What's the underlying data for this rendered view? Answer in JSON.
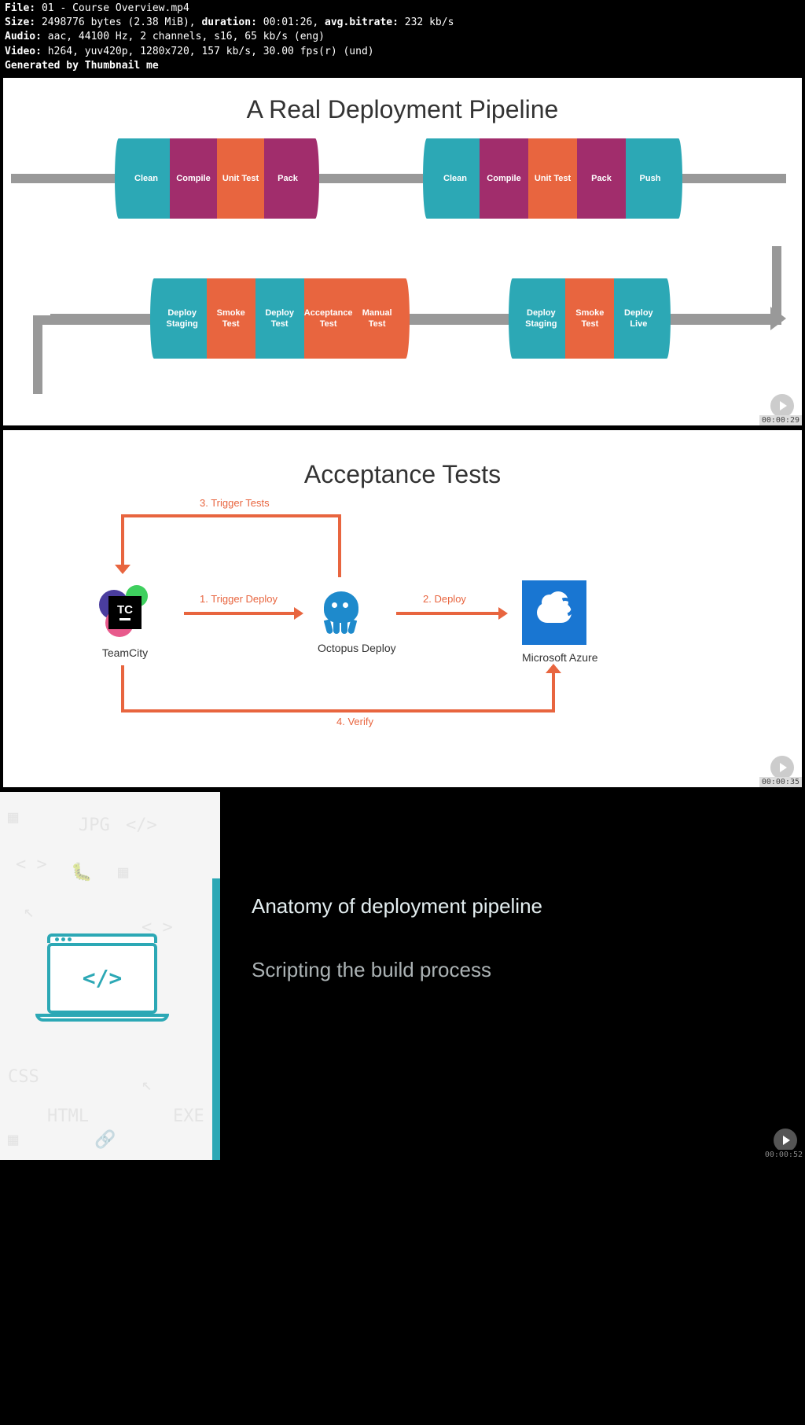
{
  "header": {
    "file_label": "File:",
    "file": "01 - Course Overview.mp4",
    "size_label": "Size:",
    "size": "2498776 bytes (2.38 MiB),",
    "duration_label": "duration:",
    "duration": "00:01:26,",
    "avgbitrate_label": "avg.bitrate:",
    "avgbitrate": "232 kb/s",
    "audio_label": "Audio:",
    "audio": "aac, 44100 Hz, 2 channels, s16, 65 kb/s (eng)",
    "video_label": "Video:",
    "video": "h264, yuv420p, 1280x720, 157 kb/s, 30.00 fps(r) (und)",
    "generated": "Generated by Thumbnail me"
  },
  "panel1": {
    "title": "A Real Deployment Pipeline",
    "row1_group1": [
      "Clean",
      "Compile",
      "Unit Test",
      "Pack"
    ],
    "row1_group2": [
      "Clean",
      "Compile",
      "Unit Test",
      "Pack",
      "Push"
    ],
    "row2_group1": [
      "Deploy Staging",
      "Smoke Test",
      "Deploy Test",
      "Acceptance Test",
      "Manual Test"
    ],
    "row2_group2": [
      "Deploy Staging",
      "Smoke Test",
      "Deploy Live"
    ],
    "timestamp": "00:00:29"
  },
  "panel2": {
    "title": "Acceptance Tests",
    "nodes": {
      "teamcity": "TeamCity",
      "octopus": "Octopus Deploy",
      "azure": "Microsoft Azure"
    },
    "arrows": {
      "a1": "1. Trigger Deploy",
      "a2": "2. Deploy",
      "a3": "3. Trigger Tests",
      "a4": "4. Verify"
    },
    "timestamp": "00:00:35"
  },
  "panel3": {
    "line1": "Anatomy of deployment pipeline",
    "line2": "Scripting the build process",
    "timestamp": "00:00:52",
    "code_symbol": "</>"
  }
}
